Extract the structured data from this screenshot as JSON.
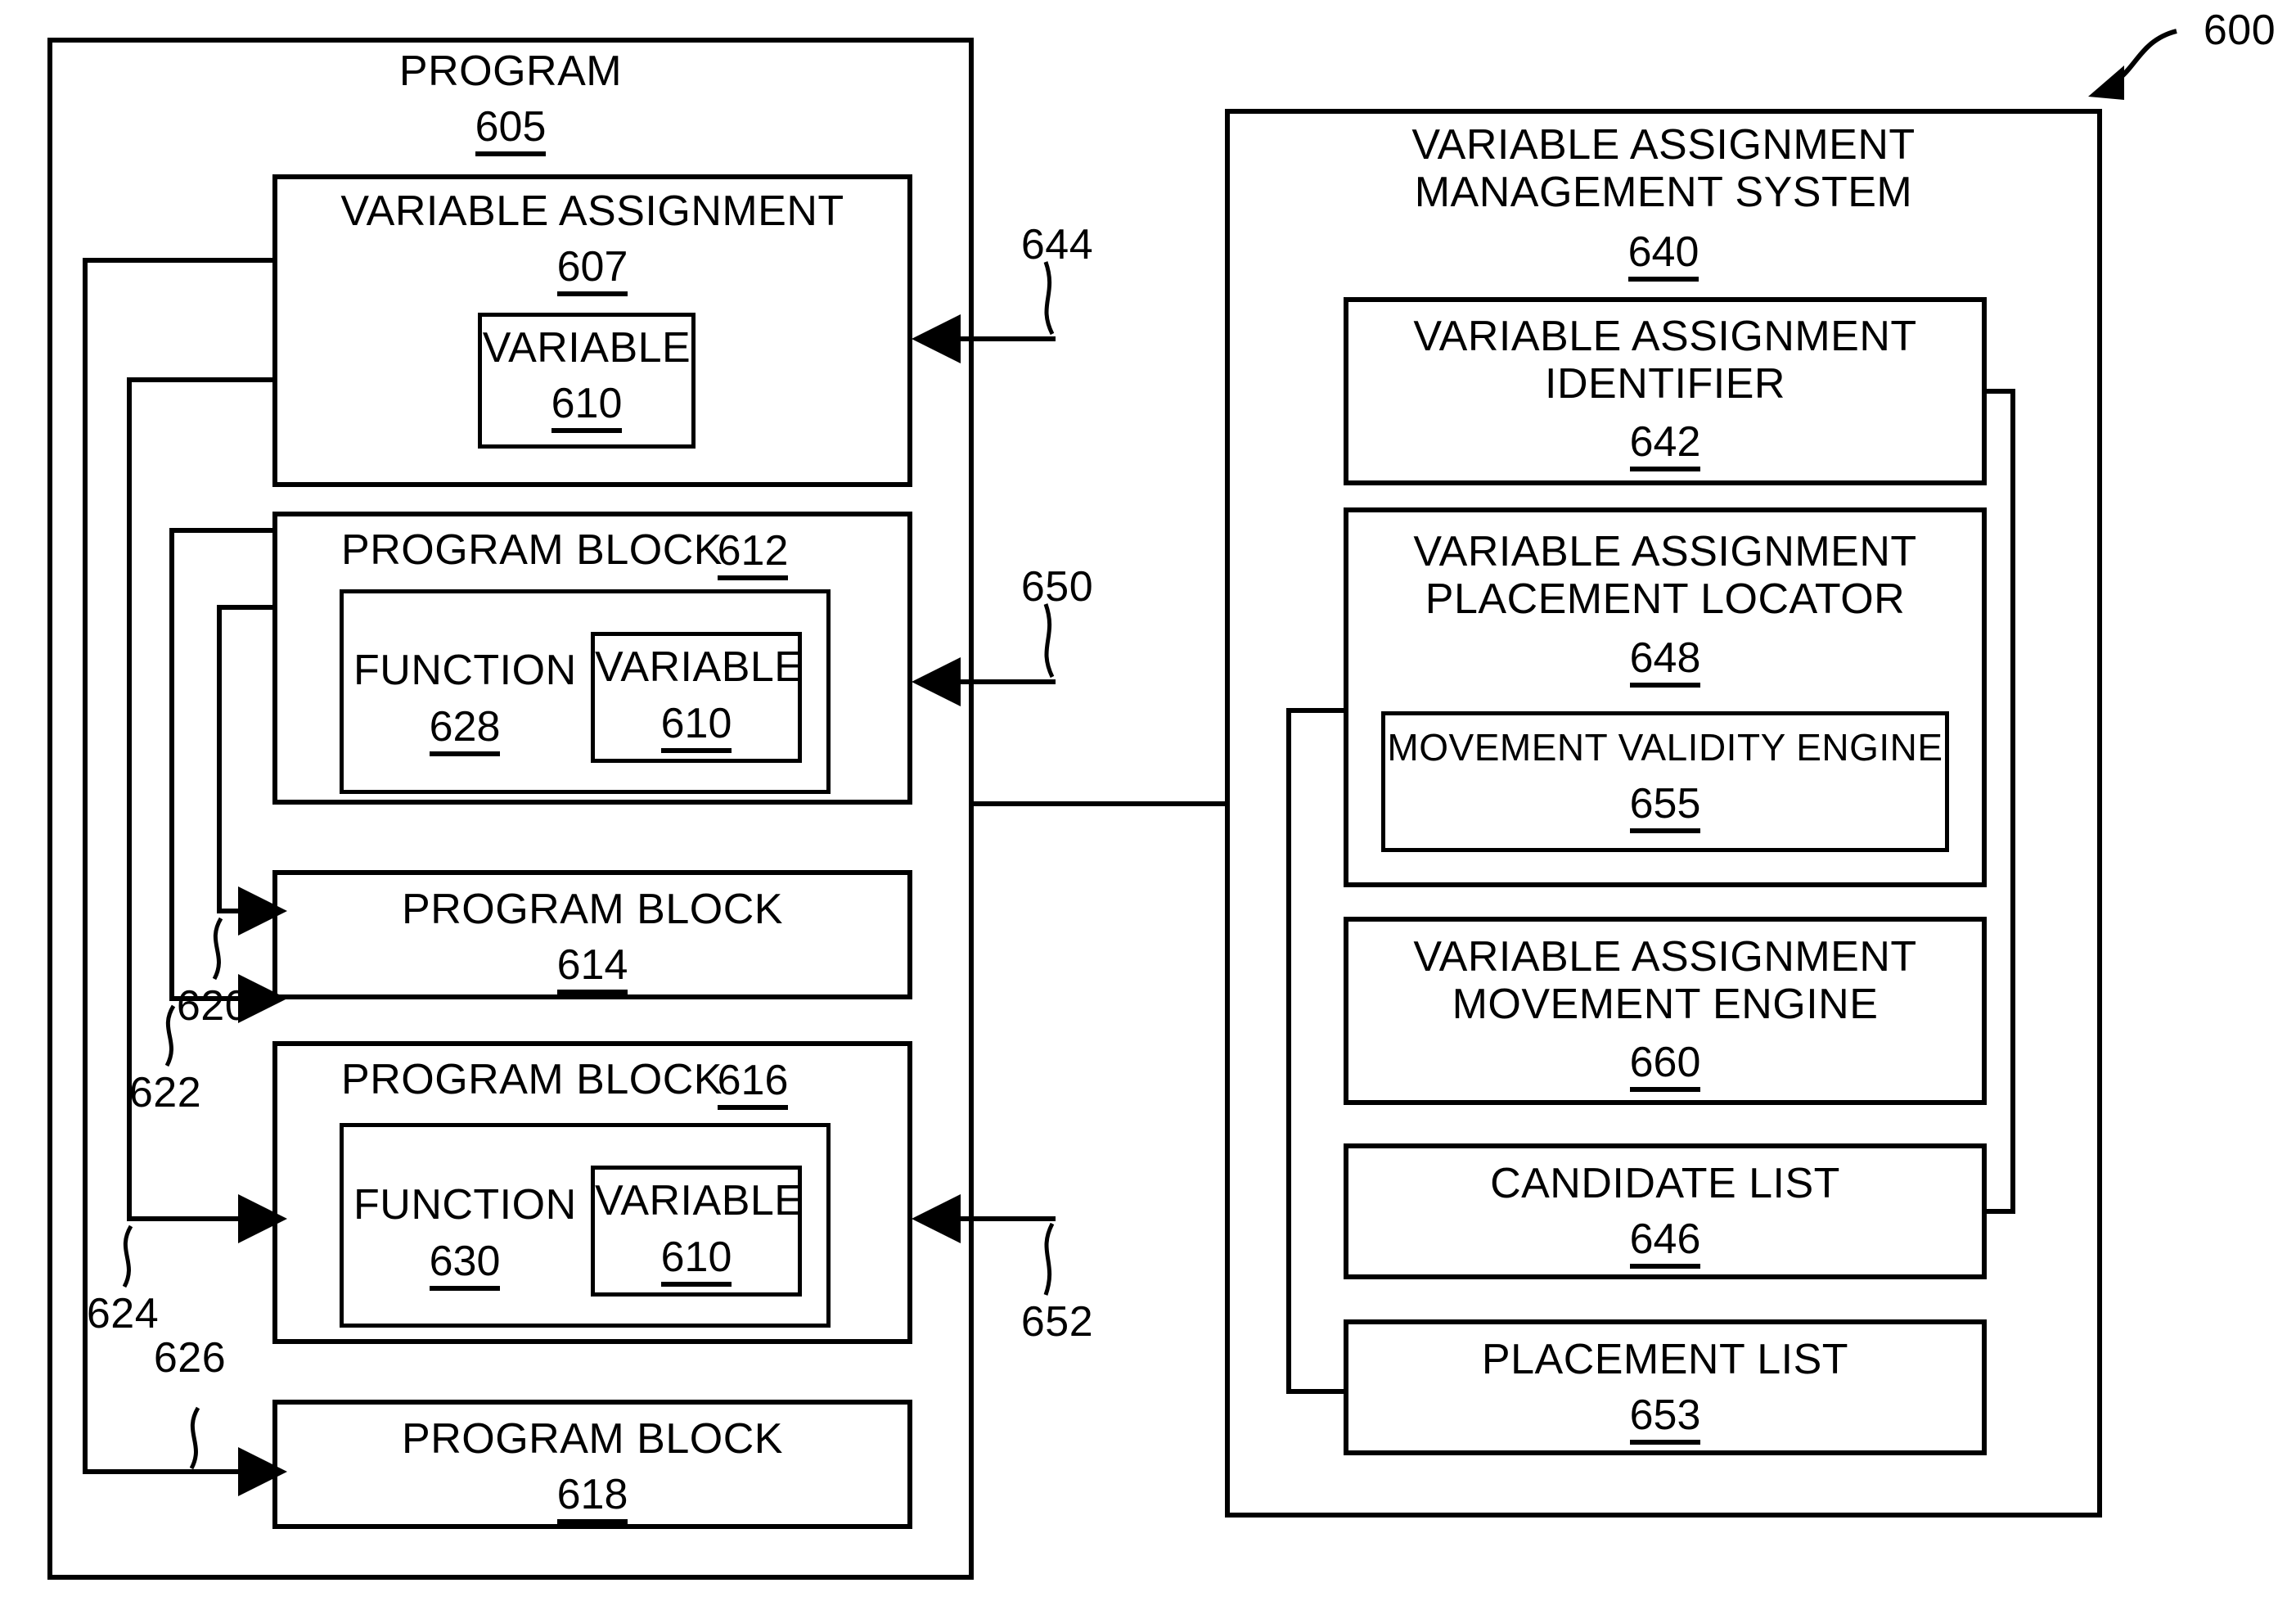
{
  "figure": {
    "number": "600",
    "type": "patent-block-diagram"
  },
  "program_panel": {
    "title": "PROGRAM",
    "number": "605",
    "variable_assignment": {
      "title": "VARIABLE ASSIGNMENT",
      "number": "607",
      "variable": {
        "title": "VARIABLE",
        "number": "610"
      }
    },
    "blocks": [
      {
        "title": "PROGRAM BLOCK",
        "number": "612",
        "function": {
          "title": "FUNCTION",
          "number": "628"
        },
        "variable": {
          "title": "VARIABLE",
          "number": "610"
        }
      },
      {
        "title": "PROGRAM BLOCK",
        "number": "614"
      },
      {
        "title": "PROGRAM BLOCK",
        "number": "616",
        "function": {
          "title": "FUNCTION",
          "number": "630"
        },
        "variable": {
          "title": "VARIABLE",
          "number": "610"
        }
      },
      {
        "title": "PROGRAM BLOCK",
        "number": "618"
      }
    ]
  },
  "system_panel": {
    "title": "VARIABLE ASSIGNMENT\nMANAGEMENT SYSTEM",
    "number": "640",
    "components": [
      {
        "title": "VARIABLE ASSIGNMENT\nIDENTIFIER",
        "number": "642"
      },
      {
        "title": "VARIABLE ASSIGNMENT\nPLACEMENT LOCATOR",
        "number": "648",
        "child": {
          "title": "MOVEMENT VALIDITY ENGINE",
          "number": "655"
        }
      },
      {
        "title": "VARIABLE ASSIGNMENT\nMOVEMENT ENGINE",
        "number": "660"
      },
      {
        "title": "CANDIDATE LIST",
        "number": "646"
      },
      {
        "title": "PLACEMENT LIST",
        "number": "653"
      }
    ]
  },
  "connector_labels": {
    "c620": "620",
    "c622": "622",
    "c624": "624",
    "c626": "626",
    "c644": "644",
    "c650": "650",
    "c652": "652"
  },
  "colors": {
    "line": "#000000",
    "background": "#ffffff"
  }
}
